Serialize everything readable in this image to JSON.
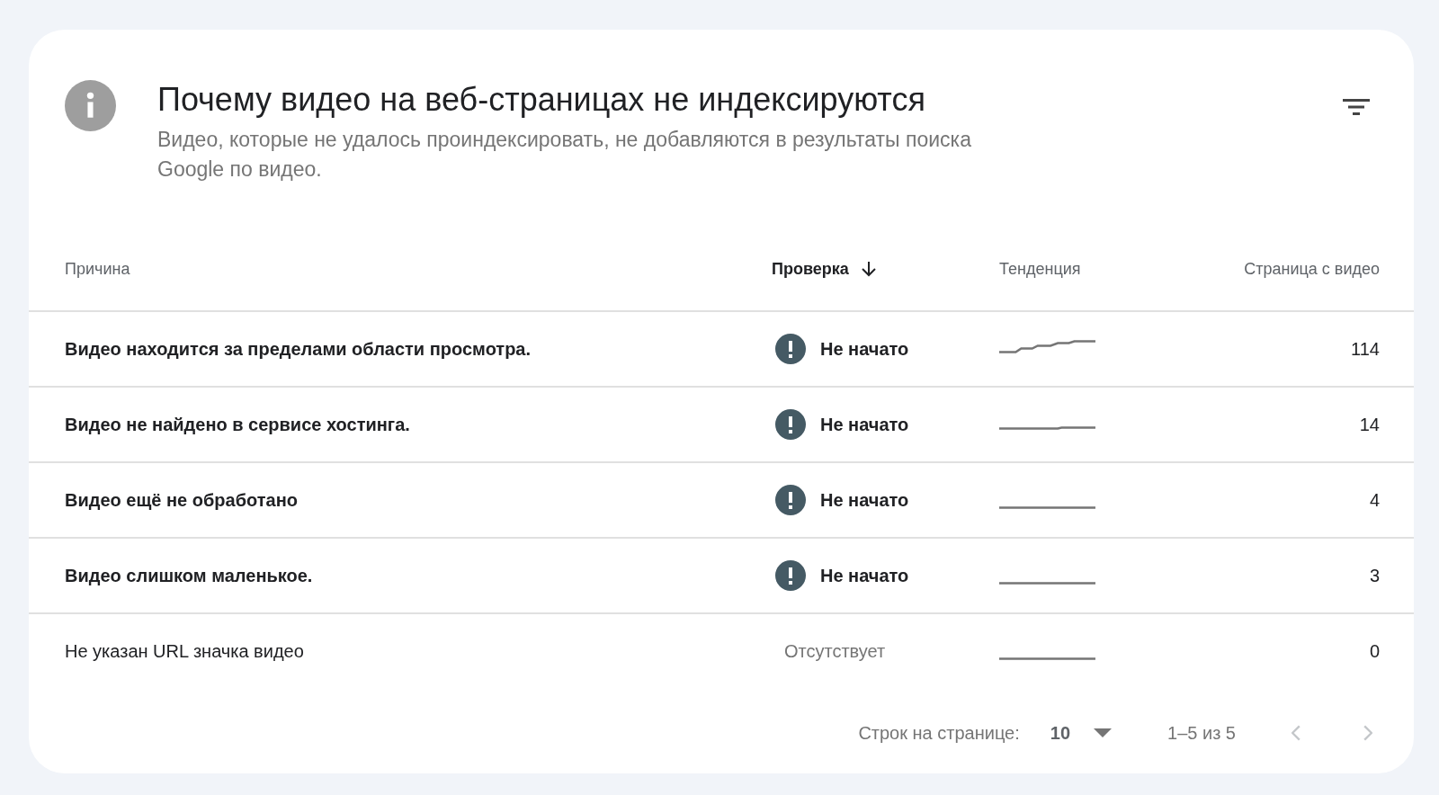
{
  "header": {
    "title": "Почему видео на веб-страницах не индексируются",
    "description": "Видео, которые не удалось проиндексировать, не добавляются в результаты поиска Google по видео."
  },
  "table": {
    "columns": [
      {
        "label": "Причина",
        "sorted": false
      },
      {
        "label": "Проверка",
        "sorted": true
      },
      {
        "label": "Тенденция",
        "sorted": false
      },
      {
        "label": "Страница с видео",
        "sorted": false
      }
    ],
    "rows": [
      {
        "kind": "not_started",
        "reason": "Видео находится за пределами области просмотра.",
        "status": "Не начато",
        "trend": {
          "kind": "rising"
        },
        "pages": "114"
      },
      {
        "kind": "not_started",
        "reason": "Видео не найдено в сервисе хостинга.",
        "status": "Не начато",
        "trend": {
          "kind": "step"
        },
        "pages": "14"
      },
      {
        "kind": "not_started",
        "reason": "Видео ещё не обработано",
        "status": "Не начато",
        "trend": {
          "kind": "flat"
        },
        "pages": "4"
      },
      {
        "kind": "not_started",
        "reason": "Видео слишком маленькое.",
        "status": "Не начато",
        "trend": {
          "kind": "flat"
        },
        "pages": "3"
      },
      {
        "kind": "missing",
        "reason": "Не указан URL значка видео",
        "status": "Отсутствует",
        "trend": {
          "kind": "flat"
        },
        "pages": "0"
      }
    ]
  },
  "pagination": {
    "rows_label": "Строк на странице:",
    "rows_value": "10",
    "range": "1–5 из 5",
    "prev_disabled": true,
    "next_disabled": true
  }
}
